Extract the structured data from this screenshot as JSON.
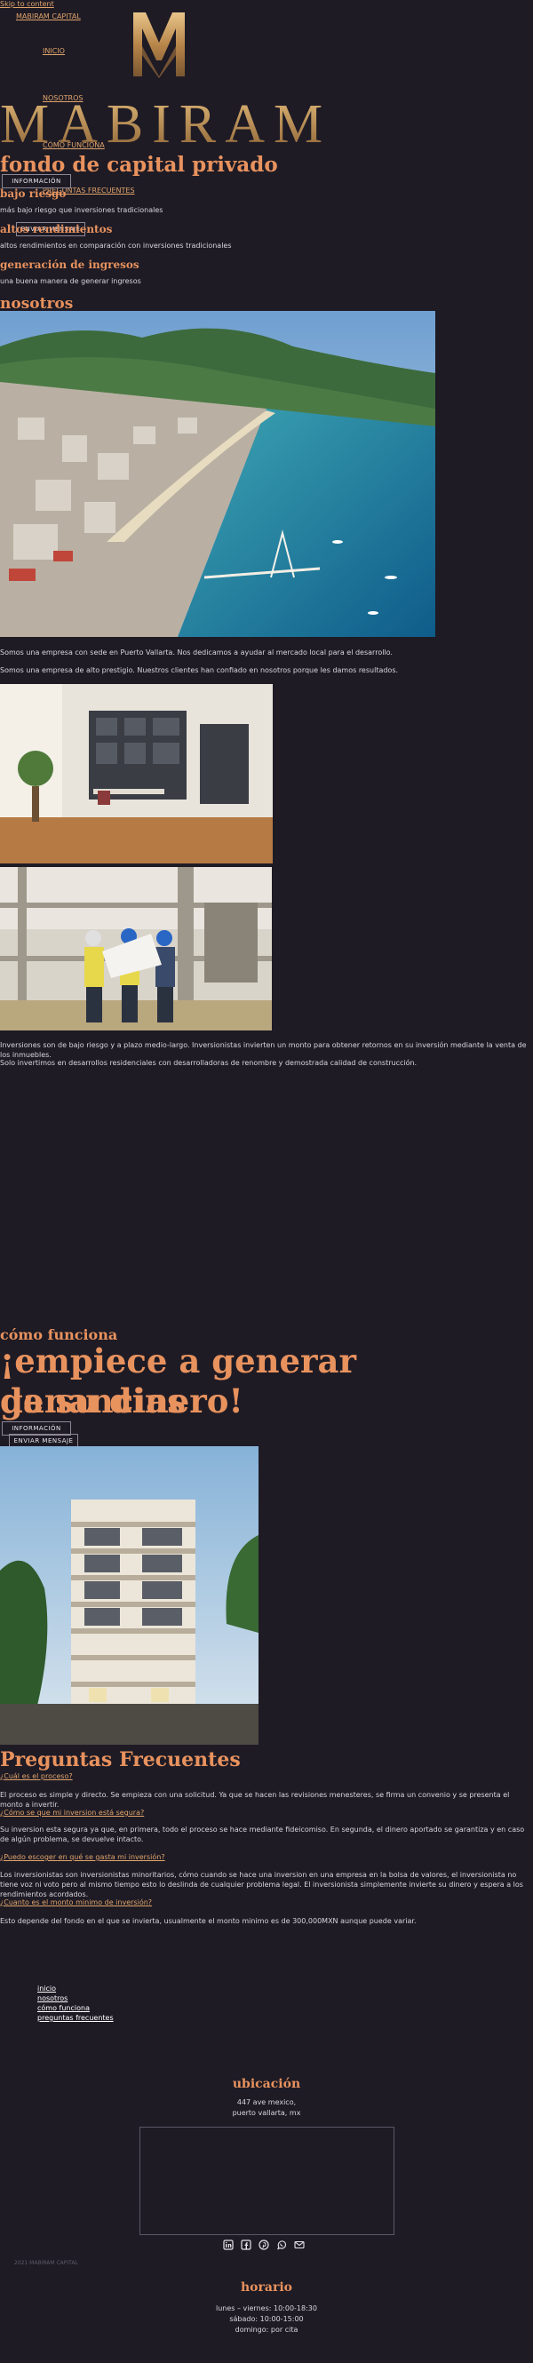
{
  "skip_link": "Skip to content",
  "nav": {
    "brand_link": "MABIRAM CAPITAL",
    "inicio": "INICIO",
    "nosotros": "NOSOTROS",
    "como_funciona": "CÓMO FUNCIONA",
    "preguntas": "PREGUNTAS FRECUENTES"
  },
  "logo": {
    "wordmark": "MABIRAM"
  },
  "hero": {
    "title": "fondo de capital privado",
    "info_button": "INFORMACIÓN",
    "contact_button": "ENVIAR MENSAJE"
  },
  "features": [
    {
      "title": "bajo riesgo",
      "text": "más bajo riesgo que inversiones tradicionales"
    },
    {
      "title": "altos rendimientos",
      "text": "altos rendimientos en comparación con inversiones tradicionales"
    },
    {
      "title": "generación de ingresos",
      "text": "una buena manera de generar ingresos"
    }
  ],
  "about": {
    "heading": "nosotros",
    "p1": "Somos una empresa con sede en Puerto Vallarta. Nos dedicamos a ayudar al mercado local para el desarrollo.",
    "p2": "Somos una empresa de alto prestigio. Nuestros clientes han confiado en nosotros porque les damos resultados.",
    "p3": "Inversiones son de bajo riesgo y a plazo medio-largo. Inversionistas invierten un monto para obtener retornos en su inversión mediante la venta de los inmuebles.",
    "p4": "Solo invertimos en desarrollos residenciales con desarrolladoras de renombre y demostrada calidad de construcción."
  },
  "how": {
    "label": "cómo funciona",
    "headline_line1": "¡empiece a generar ganancias",
    "headline_line2": "de su dinero!",
    "info_button": "INFORMACIÓN",
    "contact_button": "ENVIAR MENSAJE"
  },
  "faq": {
    "heading": "Preguntas Frecuentes",
    "items": [
      {
        "q": "¿Cuál es el proceso?",
        "a": "El proceso es simple y directo. Se empieza con una solicitud. Ya que se hacen las revisiones menesteres, se firma un convenio y se presenta el monto a invertir."
      },
      {
        "q": "¿Cómo se que mi inversion está segura?",
        "a": "Su inversion esta segura ya que, en primera, todo el proceso se hace mediante fideicomiso. En segunda, el dinero aportado se garantiza y en caso de algún problema, se devuelve intacto."
      },
      {
        "q": "¿Puedo escoger en qué se gasta mi inversión?",
        "a": "Los inversionistas son inversionistas minoritarios, cómo cuando se hace una inversion en una empresa en la bolsa de valores, el inversionista no tiene voz ni voto pero al mismo tiempo esto lo deslinda de cualquier problema legal. El inversionista simplemente invierte su dinero y espera a los rendimientos acordados."
      },
      {
        "q": "¿Cuanto es el monto minimo de inversión?",
        "a": "Esto depende del fondo en el que se invierta, usualmente el monto minimo es de 300,000MXN aunque puede variar."
      }
    ]
  },
  "footer": {
    "links": [
      "inicio",
      "nosotros",
      "cómo funciona",
      "preguntas frecuentes"
    ],
    "location_title": "ubicación",
    "address_line1": "447 ave mexico,",
    "address_line2": "puerto vallarta, mx",
    "social_icons": [
      "linkedin-icon",
      "facebook-icon",
      "pinterest-icon",
      "whatsapp-icon",
      "email-icon"
    ],
    "copyright": "2021 MABIRAM CAPITAL",
    "schedule_title": "horario",
    "schedule": [
      "lunes – viernes: 10:00-18:30",
      "sábado: 10:00-15:00",
      "domingo: por cita"
    ]
  },
  "colors": {
    "background": "#1e1b25",
    "accent": "#e8925e",
    "gold": "#c69a5c",
    "link": "#e0a46b"
  }
}
